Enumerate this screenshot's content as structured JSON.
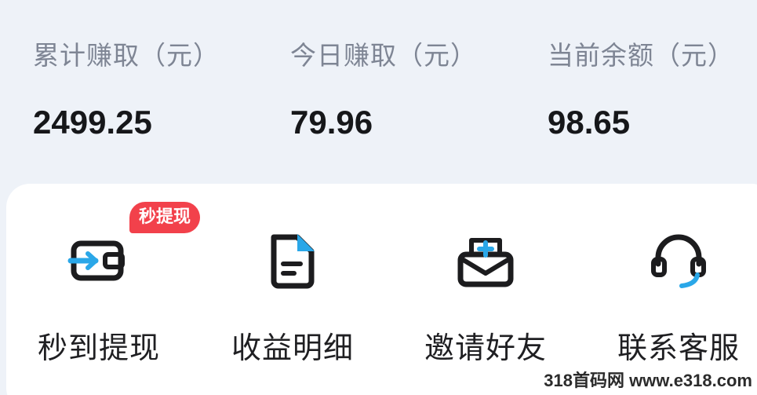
{
  "stats": [
    {
      "label": "累计赚取（元）",
      "value": "2499.25"
    },
    {
      "label": "今日赚取（元）",
      "value": "79.96"
    },
    {
      "label": "当前余额（元）",
      "value": "98.65"
    }
  ],
  "actions": [
    {
      "label": "秒到提现",
      "icon": "wallet-icon",
      "badge": "秒提现"
    },
    {
      "label": "收益明细",
      "icon": "document-icon"
    },
    {
      "label": "邀请好友",
      "icon": "envelope-plus-icon"
    },
    {
      "label": "联系客服",
      "icon": "headset-icon"
    }
  ],
  "colors": {
    "accent": "#2aa7e8",
    "badge": "#f2414b",
    "icon_stroke": "#1c1c1e",
    "label_gray": "#7e8594"
  },
  "watermark": "318首码网 www.e318.com"
}
